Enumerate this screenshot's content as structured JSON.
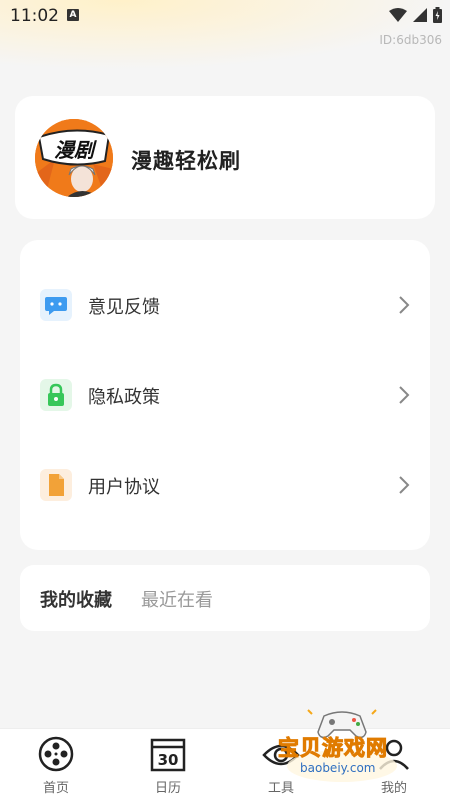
{
  "status_bar": {
    "time": "11:02",
    "notification_letter": "A"
  },
  "device_id": "ID:6db306",
  "profile": {
    "avatar_text": "漫剧",
    "app_name": "漫趣轻松刷"
  },
  "menu": {
    "items": [
      {
        "label": "意见反馈",
        "icon": "message-icon",
        "color": "#3d9bf0"
      },
      {
        "label": "隐私政策",
        "icon": "lock-icon",
        "color": "#37c75a"
      },
      {
        "label": "用户协议",
        "icon": "document-icon",
        "color": "#f2a238"
      }
    ]
  },
  "favorites": {
    "tabs": [
      "我的收藏",
      "最近在看"
    ],
    "active_tab": 0
  },
  "bottom_nav": {
    "items": [
      {
        "label": "首页",
        "icon": "film-reel-icon"
      },
      {
        "label": "日历",
        "icon": "calendar-icon",
        "day": "30"
      },
      {
        "label": "工具",
        "icon": "eye-icon"
      },
      {
        "label": "我的",
        "icon": "person-icon"
      }
    ]
  },
  "watermark": {
    "text": "宝贝游戏网",
    "url": "baobeiy.com"
  },
  "colors": {
    "background": "#f5f5f5",
    "card": "#ffffff",
    "avatar_bg": "#f07a1a"
  }
}
